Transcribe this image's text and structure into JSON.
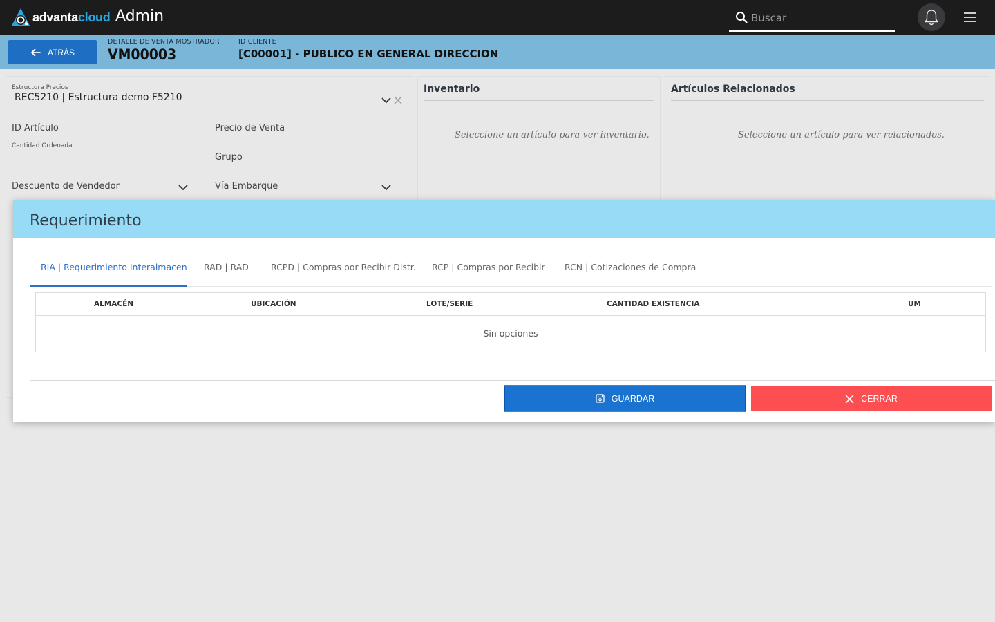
{
  "topbar": {
    "logo": {
      "part1": "advanta",
      "part2": "cloud"
    },
    "title": "Admin",
    "search_placeholder": "Buscar",
    "icons": {
      "search": "search-icon",
      "bell": "bell-icon",
      "menu": "hamburger-menu-icon"
    }
  },
  "subheader": {
    "back_label": "ATRÁS",
    "detail_label": "DETALLE DE VENTA MOSTRADOR",
    "detail_value": "VM00003",
    "client_label": "ID CLIENTE",
    "client_value": "[C00001] - PUBLICO EN GENERAL DIRECCION"
  },
  "form": {
    "price_structure_label": "Estructura Precios",
    "price_structure_value": "REC5210 | Estructura demo F5210",
    "article_id_label": "ID Artículo",
    "sale_price_label": "Precio de Venta",
    "ordered_qty_label": "Cantidad Ordenada",
    "group_label": "Grupo",
    "seller_discount_label": "Descuento de Vendedor",
    "shipping_label": "Vía Embarque"
  },
  "inventory_panel": {
    "title": "Inventario",
    "empty": "Seleccione un artículo para ver inventario."
  },
  "related_panel": {
    "title": "Artículos Relacionados",
    "empty": "Seleccione un artículo para ver relacionados."
  },
  "modal": {
    "title": "Requerimiento",
    "tabs": [
      {
        "label": "RIA | Requerimiento Interalmacen",
        "active": true
      },
      {
        "label": "RAD | RAD",
        "active": false
      },
      {
        "label": "RCPD | Compras por Recibir Distr.",
        "active": false
      },
      {
        "label": "RCP | Compras por Recibir",
        "active": false
      },
      {
        "label": "RCN | Cotizaciones de Compra",
        "active": false
      }
    ],
    "table": {
      "columns": [
        "ALMACÉN",
        "UBICACIÓN",
        "LOTE/SERIE",
        "CANTIDAD EXISTENCIA",
        "UM"
      ],
      "rows": [],
      "empty_text": "Sin opciones"
    },
    "save_label": "GUARDAR",
    "close_label": "CERRAR"
  },
  "colors": {
    "topbar": "#1c1c1d",
    "subheader": "#7ab6d8",
    "modal_header": "#97dbf6",
    "primary": "#1a73d1",
    "danger": "#fd4f52",
    "brand_accent": "#29a8e0"
  }
}
